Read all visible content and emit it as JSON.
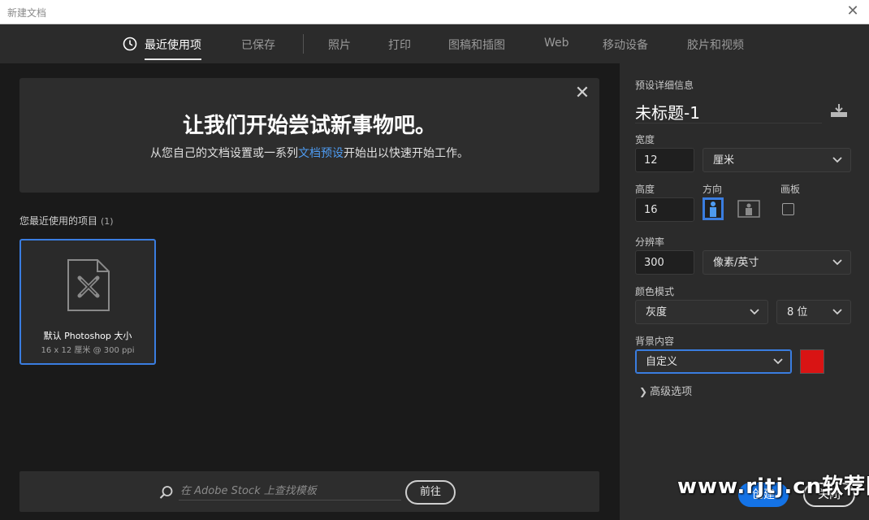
{
  "window": {
    "title": "新建文档",
    "close_icon": "close-icon"
  },
  "tabs": [
    {
      "label": "最近使用项",
      "active": true
    },
    {
      "label": "已保存"
    },
    {
      "label": "照片"
    },
    {
      "label": "打印"
    },
    {
      "label": "图稿和插图"
    },
    {
      "label": "Web"
    },
    {
      "label": "移动设备"
    },
    {
      "label": "胶片和视频"
    }
  ],
  "banner": {
    "heading": "让我们开始尝试新事物吧。",
    "sub_before": "从您自己的文档设置或一系列",
    "sub_link": "文档预设",
    "sub_after": "开始出以快速开始工作。"
  },
  "recent": {
    "label": "您最近使用的项目",
    "count": "(1)",
    "items": [
      {
        "name": "默认 Photoshop 大小",
        "size": "16 x 12 厘米 @ 300 ppi"
      }
    ]
  },
  "search": {
    "placeholder": "在 Adobe Stock 上查找模板",
    "go_label": "前往"
  },
  "preset": {
    "section_label": "预设详细信息",
    "doc_title": "未标题-1",
    "width_label": "宽度",
    "width_value": "12",
    "width_unit": "厘米",
    "height_label": "高度",
    "height_value": "16",
    "orientation_label": "方向",
    "artboard_label": "画板",
    "resolution_label": "分辨率",
    "resolution_value": "300",
    "resolution_unit": "像素/英寸",
    "color_mode_label": "颜色模式",
    "color_mode_value": "灰度",
    "bit_depth_value": "8 位",
    "background_label": "背景内容",
    "background_value": "自定义",
    "background_color": "#d91414",
    "advanced_label": "高级选项"
  },
  "actions": {
    "create_label": "创建",
    "close_label": "关闭"
  },
  "watermark": "www.rjtj.cn软荐网",
  "colors": {
    "accent": "#1473e6",
    "selection": "#3a7de0",
    "link": "#4e9bf0"
  }
}
